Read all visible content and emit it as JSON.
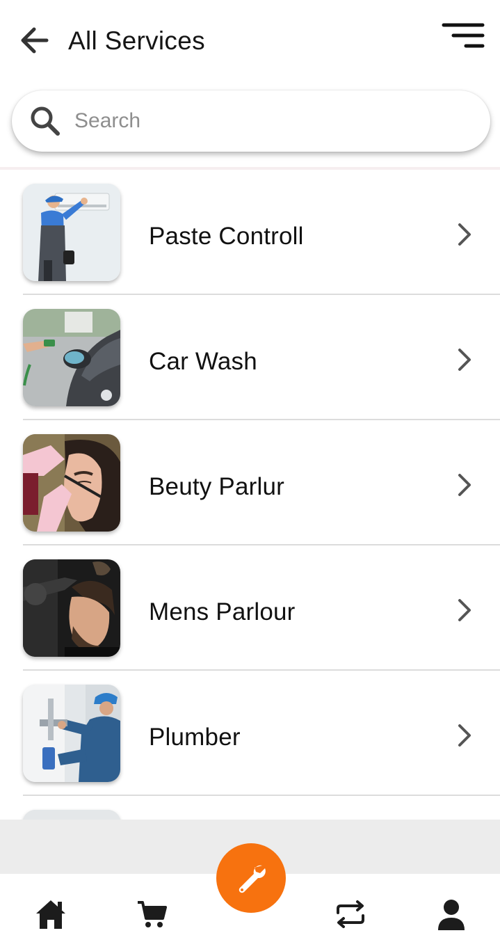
{
  "header": {
    "title": "All Services",
    "back_icon": "arrow-left-icon",
    "menu_icon": "sort-menu-icon"
  },
  "search": {
    "placeholder": "Search",
    "value": "",
    "icon": "search-icon"
  },
  "services": [
    {
      "label": "Paste Controll",
      "image": "technician-repairing-ac-photo"
    },
    {
      "label": "Car Wash",
      "image": "car-washing-photo"
    },
    {
      "label": "Beuty Parlur",
      "image": "eyebrow-treatment-photo"
    },
    {
      "label": "Mens Parlour",
      "image": "barber-styling-hair-photo"
    },
    {
      "label": "Plumber",
      "image": "plumber-fixing-pipes-photo"
    }
  ],
  "bottom_nav": {
    "items": [
      {
        "icon": "home-icon"
      },
      {
        "icon": "cart-icon"
      },
      {
        "icon": "wrench-icon",
        "active": true
      },
      {
        "icon": "repeat-icon"
      },
      {
        "icon": "user-icon"
      }
    ]
  },
  "colors": {
    "accent": "#f7720f",
    "divider": "#dcdcdc",
    "band": "#ececec"
  }
}
